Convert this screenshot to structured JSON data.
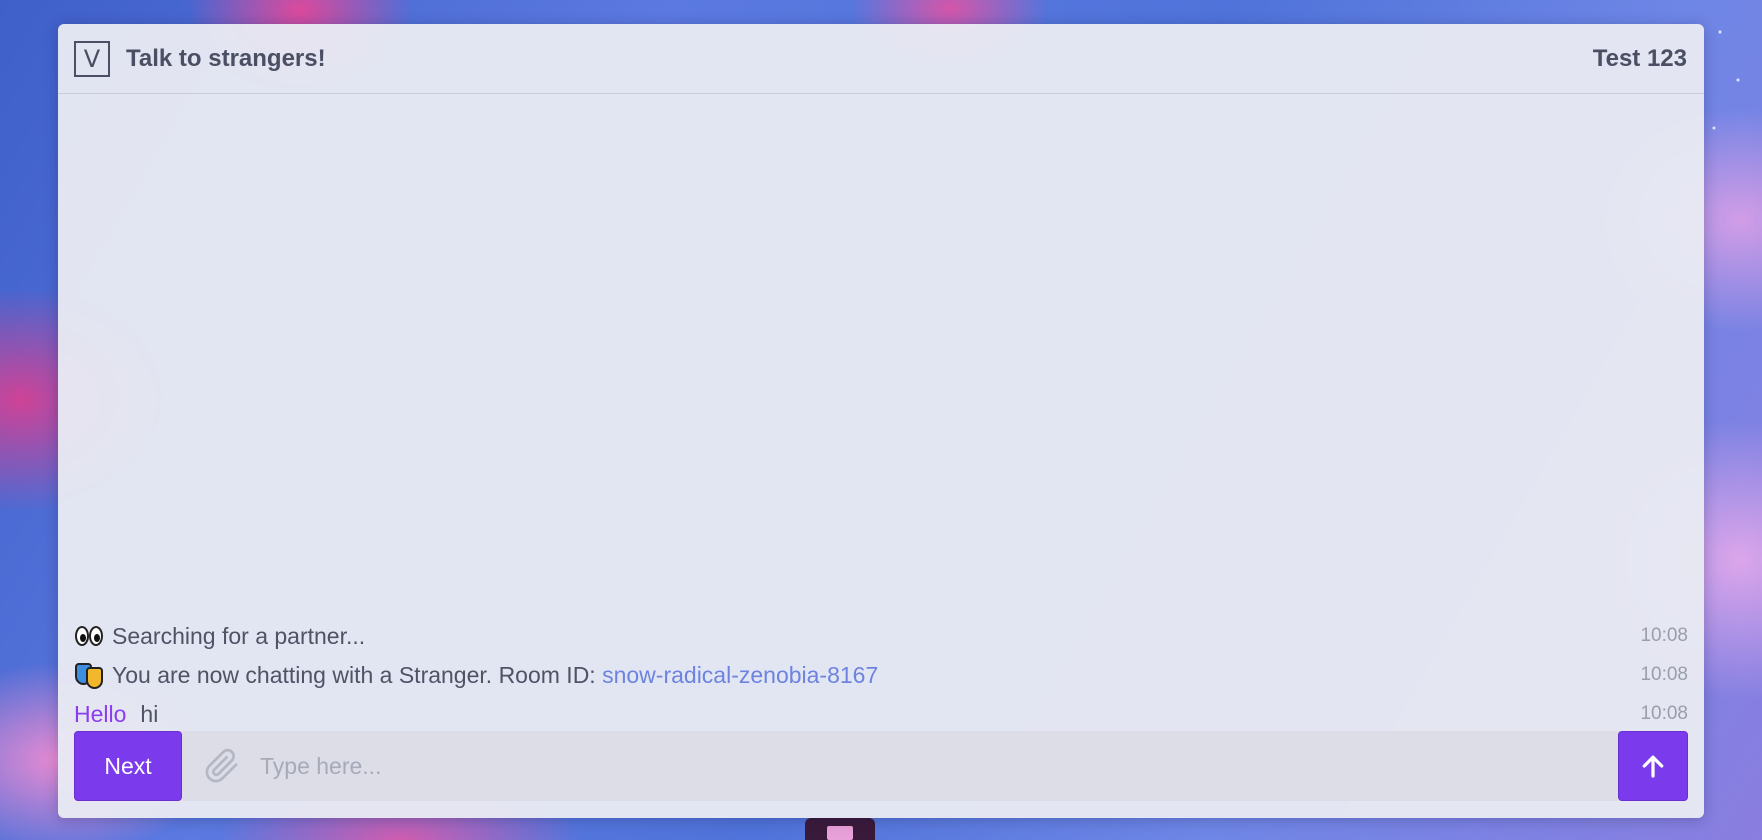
{
  "header": {
    "logo_letter": "V",
    "title": "Talk to strangers!",
    "username": "Test 123"
  },
  "messages": [
    {
      "type": "system",
      "icon": "eyes-icon",
      "text": "Searching for a partner...",
      "time": "10:08"
    },
    {
      "type": "system",
      "icon": "masks-icon",
      "text": "You are now chatting with a Stranger. Room ID:",
      "room_id": "snow-radical-zenobia-8167",
      "time": "10:08"
    },
    {
      "type": "chat",
      "nick": "Hello",
      "text": "hi",
      "time": "10:08"
    }
  ],
  "composer": {
    "next_label": "Next",
    "placeholder": "Type here...",
    "value": ""
  },
  "colors": {
    "accent": "#7c3aed",
    "link": "#6e83e0",
    "nick": "#8a3df0",
    "text": "#4e5366"
  }
}
